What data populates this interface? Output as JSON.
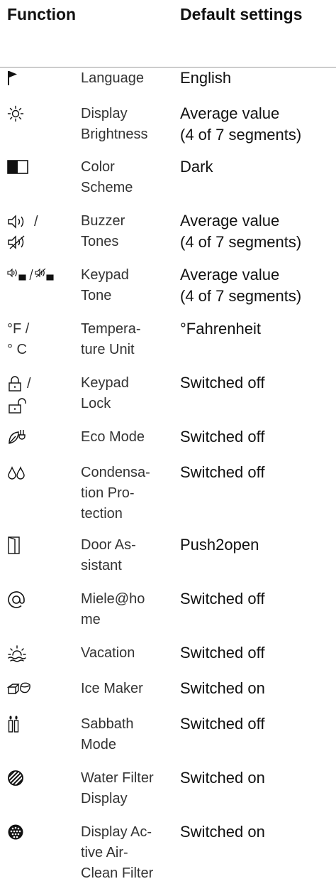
{
  "header": {
    "function": "Function",
    "default": "Default settings"
  },
  "rows": [
    {
      "icon": "flag-icon",
      "glyph": "⚑",
      "function": [
        "Language"
      ],
      "value": [
        "English"
      ]
    },
    {
      "icon": "brightness-icon",
      "glyph": "☼",
      "function": [
        "Display",
        "Brightness"
      ],
      "value": [
        "Average value",
        "(4 of 7 segments)"
      ]
    },
    {
      "icon": "color-scheme-icon",
      "glyph": "",
      "function": [
        "Color",
        "Scheme"
      ],
      "value": [
        "Dark"
      ]
    },
    {
      "icon": "buzzer-icon",
      "glyph": "🕪 /",
      "glyph2": "🔇",
      "function": [
        "Buzzer",
        "Tones"
      ],
      "value": [
        "Average value",
        "(4 of 7 segments)"
      ]
    },
    {
      "icon": "keypad-tone-icon",
      "glyph": "🕪▦/🔇▦",
      "function": [
        "Keypad",
        "Tone"
      ],
      "value": [
        "Average value",
        "(4 of 7 segments)"
      ]
    },
    {
      "icon": "temperature-unit-icon",
      "glyph": "°F /",
      "glyph2": "° C",
      "function": [
        "Tempera-",
        "ture Unit"
      ],
      "value": [
        "°Fahrenheit"
      ]
    },
    {
      "icon": "lock-icon",
      "glyph": "🔒︎ /",
      "glyph2": "🔓︎",
      "function": [
        "Keypad",
        "Lock"
      ],
      "value": [
        "Switched off"
      ]
    },
    {
      "icon": "eco-mode-icon",
      "glyph": "❦",
      "function": [
        "Eco Mode"
      ],
      "value": [
        "Switched off"
      ]
    },
    {
      "icon": "condensation-icon",
      "glyph": "ᐤᐤ",
      "function": [
        "Condensa-",
        "tion Pro-",
        "tection"
      ],
      "value": [
        "Switched off"
      ]
    },
    {
      "icon": "door-icon",
      "glyph": "▯",
      "function": [
        "Door As-",
        "sistant"
      ],
      "value": [
        "Push2open"
      ]
    },
    {
      "icon": "at-icon",
      "glyph": "@",
      "function": [
        "Miele@ho",
        "me"
      ],
      "value": [
        "Switched off"
      ]
    },
    {
      "icon": "vacation-icon",
      "glyph": "☼",
      "function": [
        "Vacation"
      ],
      "value": [
        "Switched off"
      ]
    },
    {
      "icon": "ice-maker-icon",
      "glyph": "⬡⬡",
      "function": [
        "Ice Maker"
      ],
      "value": [
        "Switched on"
      ]
    },
    {
      "icon": "sabbath-icon",
      "glyph": "ıı",
      "function": [
        "Sabbath",
        "Mode"
      ],
      "value": [
        "Switched off"
      ]
    },
    {
      "icon": "water-filter-icon",
      "glyph": "◍",
      "function": [
        "Water Filter",
        "Display"
      ],
      "value": [
        "Switched on"
      ]
    },
    {
      "icon": "air-filter-icon",
      "glyph": "◉",
      "function": [
        "Display Ac-",
        "tive Air-",
        "Clean Filter"
      ],
      "value": [
        "Switched on"
      ]
    }
  ]
}
